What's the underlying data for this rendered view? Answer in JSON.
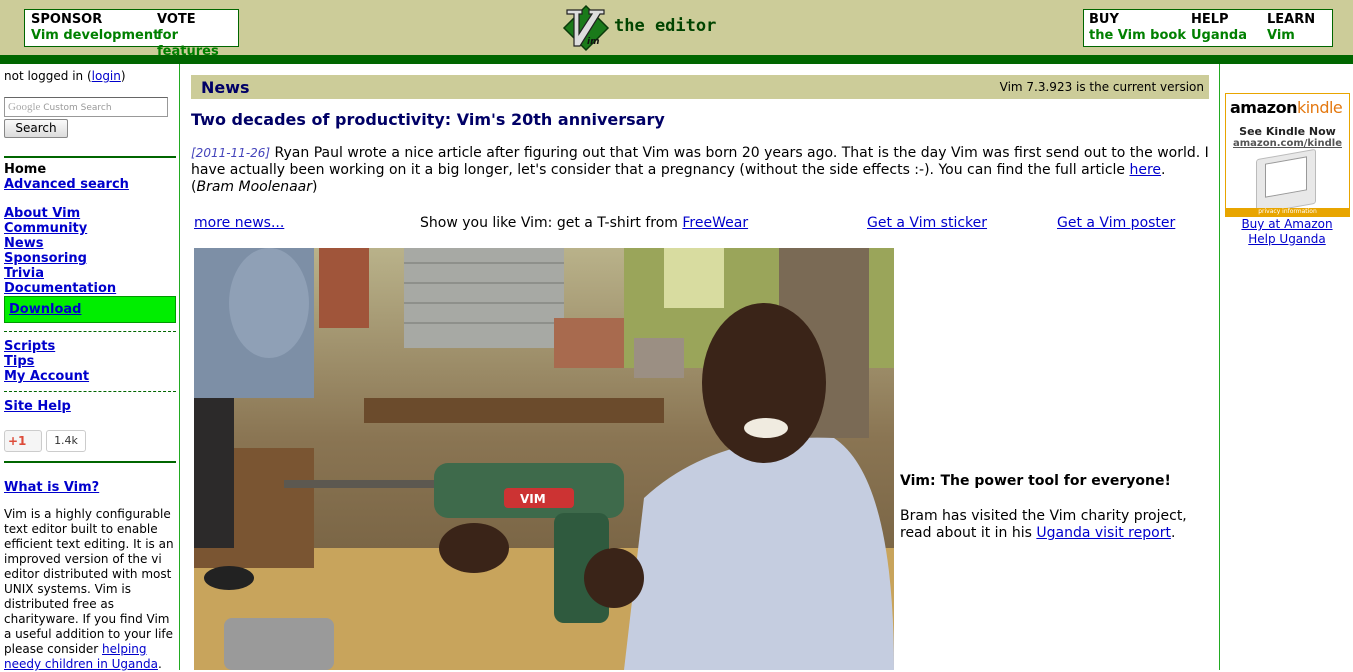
{
  "header": {
    "sponsor_title": "SPONSOR",
    "sponsor_sub": "Vim development",
    "vote_title": "VOTE",
    "vote_sub": "for features",
    "logo_text": "the editor",
    "buy_title": "BUY",
    "buy_sub": "the Vim book",
    "help_title": "HELP",
    "help_sub": "Uganda",
    "learn_title": "LEARN",
    "learn_sub": "Vim"
  },
  "sidebar": {
    "login_prefix": "not logged in (",
    "login_link": "login",
    "login_suffix": ")",
    "search_placeholder_brand": "Google",
    "search_placeholder": "Custom Search",
    "search_button": "Search",
    "home": "Home",
    "advanced_search": "Advanced search",
    "group1": [
      "About Vim",
      "Community",
      "News",
      "Sponsoring",
      "Trivia",
      "Documentation"
    ],
    "download": "Download",
    "group2": [
      "Scripts",
      "Tips",
      "My Account"
    ],
    "site_help": "Site Help",
    "gplus_label": "+1",
    "gplus_count": "1.4k",
    "what_is_vim": "What is Vim?",
    "desc_text": "Vim is a highly configurable text editor built to enable efficient text editing. It is an improved version of the vi editor distributed with most UNIX systems. Vim is distributed free as charityware. If you find Vim a useful addition to your life please consider ",
    "desc_link": "helping needy children in Uganda",
    "desc_end": "."
  },
  "main": {
    "news_title": "News",
    "version": "Vim 7.3.923 is the current version",
    "headline": "Two decades of productivity: Vim's 20th anniversary",
    "article_date": "[2011-11-26]",
    "article_text": " Ryan Paul wrote a nice article after figuring out that Vim was born 20 years ago. That is the day Vim was first send out to the world. I have actually been working on it a big longer, let's consider that a pregnancy (without the side effects :-). You can find the full article ",
    "article_link": "here",
    "article_after": ". (",
    "article_author": "Bram Moolenaar",
    "article_close": ")",
    "more_news": "more news...",
    "tshirt_text": "Show you like Vim: get a T-shirt from ",
    "tshirt_link": "FreeWear",
    "sticker": "Get a Vim sticker",
    "poster": "Get a Vim poster",
    "tagline": "Vim: The power tool for everyone!",
    "tag_text": "Bram has visited the Vim charity project, read about it in his ",
    "tag_link": "Uganda visit report",
    "tag_end": "."
  },
  "right": {
    "amazon_brand": "amazon",
    "amazon_kindle": "kindle",
    "kindle_now": "See Kindle Now",
    "amazon_url": "amazon.com/kindle",
    "privacy": "privacy information",
    "buy_amazon": "Buy at Amazon",
    "help_uganda": "Help Uganda"
  },
  "colors": {
    "header_bg": "#cccc99",
    "green_bar": "#006600",
    "download_bg": "#00ee00",
    "link": "#0000cc",
    "title_navy": "#000066"
  }
}
